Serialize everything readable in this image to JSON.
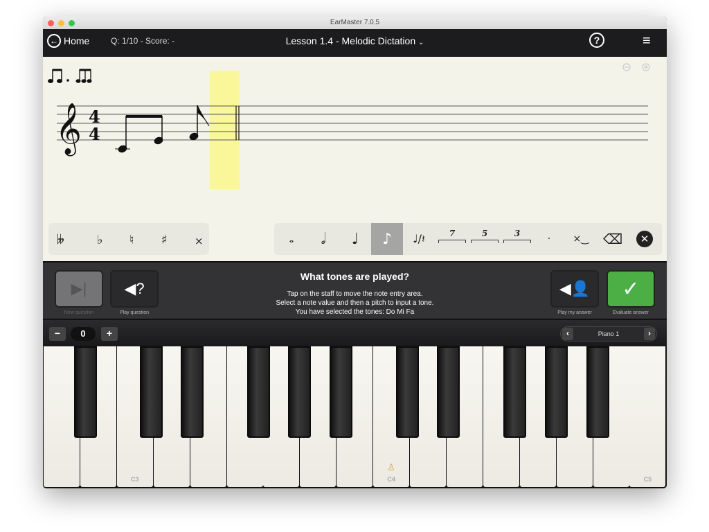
{
  "window": {
    "title": "EarMaster 7.0.5"
  },
  "nav": {
    "home_label": "Home",
    "score_text": "Q: 1/10 - Score: -",
    "lesson_title": "Lesson 1.4 - Melodic Dictation",
    "help": "?",
    "progress": {
      "current": 1,
      "total": 10
    }
  },
  "accidentals": [
    {
      "name": "double-flat",
      "glyph": "𝄫"
    },
    {
      "name": "flat",
      "glyph": "♭"
    },
    {
      "name": "natural",
      "glyph": "♮"
    },
    {
      "name": "sharp",
      "glyph": "♯"
    },
    {
      "name": "double-sharp",
      "glyph": "×"
    }
  ],
  "note_values": [
    {
      "name": "whole",
      "glyph": "𝅝"
    },
    {
      "name": "half",
      "glyph": "𝅗𝅥"
    },
    {
      "name": "quarter",
      "glyph": "♩"
    },
    {
      "name": "eighth",
      "glyph": "♪",
      "selected": true
    }
  ],
  "tuplets": [
    "7",
    "5",
    "3"
  ],
  "instructions": {
    "question": "What tones are played?",
    "line1": "Tap on the staff to move the note entry area.",
    "line2": "Select a note value and then a pitch to input a tone.",
    "line3": "You have selected the tones: Do  Mi  Fa"
  },
  "buttons": {
    "new_question": "New question",
    "play_question": "Play question",
    "play_answer": "Play my answer",
    "evaluate": "Evaluate answer"
  },
  "transpose": {
    "minus": "−",
    "value": "0",
    "plus": "+"
  },
  "instrument": {
    "label": "Piano 1",
    "prev": "‹",
    "next": "›"
  },
  "keys": {
    "labels": [
      "C3",
      "C4",
      "C5"
    ]
  },
  "colors": {
    "accent": "#5b7fc4",
    "evaluate": "#4caf45",
    "highlight": "#f9f79a"
  }
}
